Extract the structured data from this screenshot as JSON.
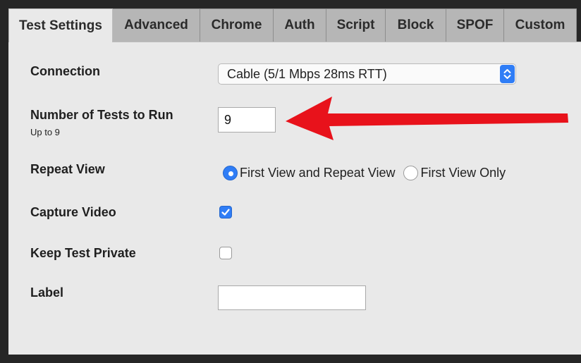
{
  "tabs": [
    {
      "label": "Test Settings",
      "active": true
    },
    {
      "label": "Advanced"
    },
    {
      "label": "Chrome"
    },
    {
      "label": "Auth"
    },
    {
      "label": "Script"
    },
    {
      "label": "Block"
    },
    {
      "label": "SPOF"
    },
    {
      "label": "Custom"
    }
  ],
  "form": {
    "connection": {
      "label": "Connection",
      "value": "Cable (5/1 Mbps 28ms RTT)"
    },
    "num_tests": {
      "label": "Number of Tests to Run",
      "hint": "Up to 9",
      "value": "9"
    },
    "repeat_view": {
      "label": "Repeat View",
      "options": [
        "First View and Repeat View",
        "First View Only"
      ],
      "selected": "First View and Repeat View"
    },
    "capture_video": {
      "label": "Capture Video",
      "checked": true
    },
    "keep_private": {
      "label": "Keep Test Private",
      "checked": false
    },
    "test_label": {
      "label": "Label",
      "value": ""
    }
  },
  "colors": {
    "accent": "#2f7df6",
    "annotation_arrow": "#e8121b"
  },
  "icons": {
    "select_stepper": "chevron-up-down-icon",
    "checkmark": "checkmark-icon",
    "annotation": "red-arrow-annotation"
  }
}
